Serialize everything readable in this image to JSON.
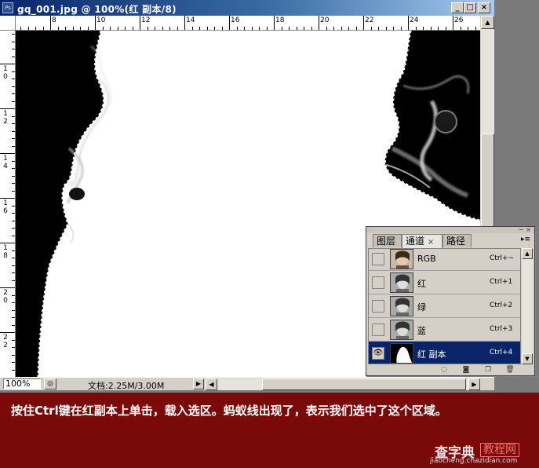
{
  "window": {
    "title": "gq_001.jpg @ 100%(红 副本/8)",
    "icon": "photoshop-doc-icon",
    "buttons": {
      "minimize": "_",
      "maximize": "□",
      "close": "×"
    }
  },
  "ruler": {
    "h_labels": [
      "8",
      "10",
      "12",
      "14",
      "16",
      "18",
      "20",
      "22",
      "24",
      "26"
    ],
    "v_labels": [
      "1\n0",
      "1\n2",
      "1\n4",
      "1\n6",
      "1\n8",
      "2\n0",
      "2\n2"
    ]
  },
  "status": {
    "zoom": "100%",
    "doc_size": "文档:2.25M/3.00M",
    "menu_arrow": "▶"
  },
  "channels_panel": {
    "tabs": [
      "图层",
      "通道",
      "路径"
    ],
    "active_tab": "通道",
    "close_glyph": "×",
    "menu_icon": "panel-menu-icon",
    "channels": [
      {
        "name": "RGB",
        "shortcut": "Ctrl+~",
        "visible": false,
        "selected": false,
        "thumb": "color"
      },
      {
        "name": "红",
        "shortcut": "Ctrl+1",
        "visible": false,
        "selected": false,
        "thumb": "gray"
      },
      {
        "name": "绿",
        "shortcut": "Ctrl+2",
        "visible": false,
        "selected": false,
        "thumb": "gray"
      },
      {
        "name": "蓝",
        "shortcut": "Ctrl+3",
        "visible": false,
        "selected": false,
        "thumb": "gray"
      },
      {
        "name": "红 副本",
        "shortcut": "Ctrl+4",
        "visible": true,
        "selected": true,
        "thumb": "mask"
      }
    ],
    "footer_icons": [
      "load-selection-icon",
      "save-selection-icon",
      "new-channel-icon",
      "trash-icon"
    ]
  },
  "caption": {
    "line": "按住Ctrl键在红副本上单击，载入选区。蚂蚁线出现了，表示我们选中了这个区域。"
  },
  "watermark": {
    "brand": "查字典",
    "tag": "教程网",
    "url": "jiaocheng.chazidian.com"
  },
  "colors": {
    "titlebar": "#0a246a",
    "selected_row": "#0a246a",
    "caption_bg": "#7a0a0a"
  }
}
